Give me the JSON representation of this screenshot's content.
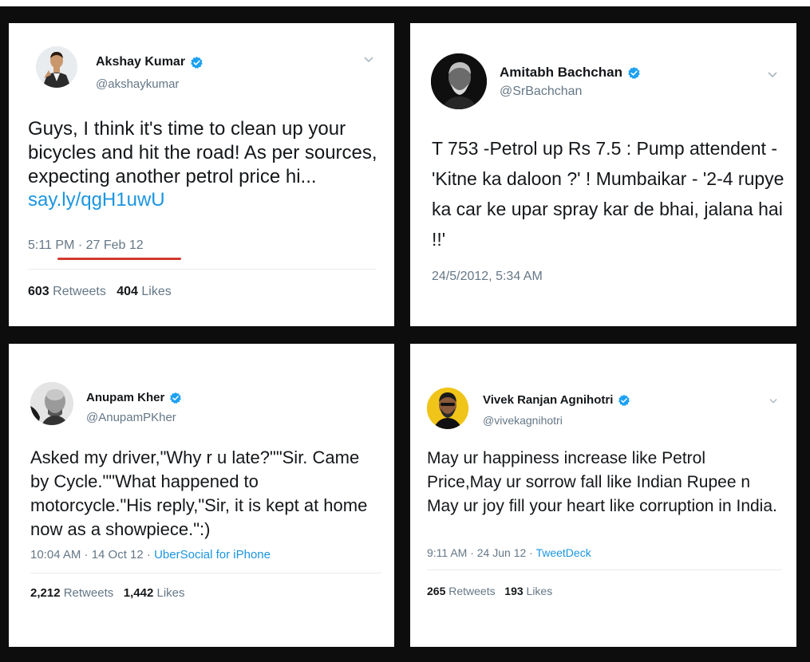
{
  "tweets": [
    {
      "name": "Akshay Kumar",
      "handle": "@akshaykumar",
      "text": "Guys, I think it's time to clean up your bicycles  and hit the road! As per sources, expecting another petrol price hi...",
      "link": "say.ly/qgH1uwU",
      "time": "5:11 PM · 27 Feb 12",
      "retweets_count": "603",
      "retweets_label": "Retweets",
      "likes_count": "404",
      "likes_label": "Likes"
    },
    {
      "name": "Amitabh Bachchan",
      "handle": "@SrBachchan",
      "text": "T 753 -Petrol up Rs 7.5 : Pump attendent - 'Kitne ka daloon ?' ! Mumbaikar - '2-4 rupye ka car ke upar spray kar de bhai, jalana  hai !!'",
      "time": "24/5/2012, 5:34 AM"
    },
    {
      "name": "Anupam Kher",
      "handle": "@AnupamPKher",
      "text": "Asked my driver,\"Why r u late?\"\"Sir. Came by Cycle.\"\"What happened to motorcycle.\"His reply,\"Sir, it is kept at home now as a showpiece.\":)",
      "time": "10:04 AM · 14 Oct 12 · ",
      "source": "UberSocial for iPhone",
      "retweets_count": "2,212",
      "retweets_label": "Retweets",
      "likes_count": "1,442",
      "likes_label": "Likes"
    },
    {
      "name": "Vivek Ranjan Agnihotri",
      "handle": "@vivekagnihotri",
      "text": "May ur happiness increase like Petrol Price,May ur sorrow fall like Indian Rupee n May ur joy fill your heart like corruption in India.",
      "time": "9:11 AM · 24 Jun 12 · ",
      "source": "TweetDeck",
      "retweets_count": "265",
      "retweets_label": "Retweets",
      "likes_count": "193",
      "likes_label": "Likes"
    }
  ],
  "colors": {
    "verified": "#1da1f2",
    "link": "#1b95e0",
    "secondary_text": "#657786",
    "underline": "#d23a2e",
    "frame": "#0d0d0d"
  }
}
